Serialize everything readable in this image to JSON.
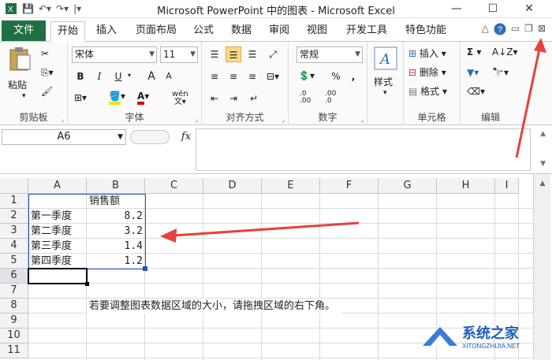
{
  "window": {
    "title": "Microsoft PowerPoint 中的图表 - Microsoft Excel"
  },
  "tabs": {
    "file": "文件",
    "items": [
      "开始",
      "插入",
      "页面布局",
      "公式",
      "数据",
      "审阅",
      "视图",
      "开发工具",
      "特色功能"
    ]
  },
  "ribbon": {
    "clipboard": {
      "label": "剪贴板",
      "paste": "粘贴"
    },
    "font": {
      "label": "字体",
      "name": "宋体",
      "size": "11",
      "bold": "B",
      "italic": "I",
      "underline": "U",
      "grow": "A",
      "shrink": "A",
      "wen": "wén"
    },
    "align": {
      "label": "对齐方式"
    },
    "number": {
      "label": "数字",
      "format": "常规",
      "percent": "%",
      "comma": ",",
      "inc": ".0\n.00",
      "dec": ".00\n.0"
    },
    "styles": {
      "label": "样式"
    },
    "cells": {
      "label": "单元格",
      "insert": "插入",
      "delete": "删除",
      "format": "格式"
    },
    "editing": {
      "label": "编辑"
    }
  },
  "formula_bar": {
    "namebox": "A6",
    "fx": "fx",
    "content": ""
  },
  "sheet": {
    "columns": [
      "A",
      "B",
      "C",
      "D",
      "E",
      "F",
      "G",
      "H",
      "I"
    ],
    "rows": [
      "1",
      "2",
      "3",
      "4",
      "5",
      "6",
      "7",
      "8",
      "9",
      "10",
      "11"
    ],
    "cells": {
      "b1": "销售额",
      "a2": "第一季度",
      "b2": "8.2",
      "a3": "第二季度",
      "b3": "3.2",
      "a4": "第三季度",
      "b4": "1.4",
      "a5": "第四季度",
      "b5": "1.2",
      "b8": "若要调整图表数据区域的大小，请拖拽区域的右下角。"
    }
  },
  "watermark": {
    "main": "系统之家",
    "sub": "XITONGZHIJIA.NET"
  },
  "colors": {
    "file_tab": "#1e7145",
    "annotation_arrow": "#e8403a",
    "selection_border": "#2a4dc4",
    "cursor_cell": "#000000"
  }
}
